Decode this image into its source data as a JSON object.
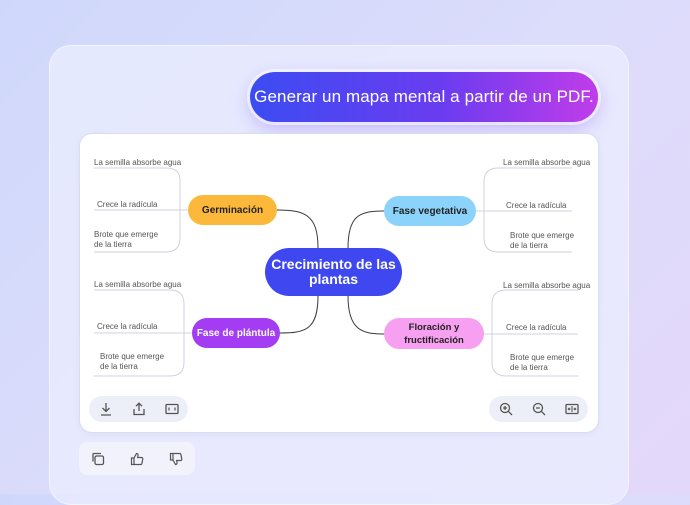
{
  "prompt": {
    "text": "Generar un mapa mental a partir de un PDF."
  },
  "mindmap": {
    "center": "Crecimiento de las plantas",
    "branches": [
      {
        "id": "germ",
        "label": "Germinación",
        "color": "#fcb83b",
        "leaves": [
          "La semilla absorbe agua",
          "Crece la radícula",
          "Brote que emerge de la tierra"
        ]
      },
      {
        "id": "veg",
        "label": "Fase vegetativa",
        "color": "#8bd3fb",
        "leaves": [
          "La semilla absorbe agua",
          "Crece la radícula",
          "Brote que emerge de la tierra"
        ]
      },
      {
        "id": "plant",
        "label": "Fase de plántula",
        "color": "#a43cf4",
        "leaves": [
          "La semilla absorbe agua",
          "Crece la radícula",
          "Brote que emerge de la tierra"
        ]
      },
      {
        "id": "flor",
        "label": "Floración y fructificación",
        "color": "#f79ff0",
        "leaves": [
          "La semilla absorbe agua",
          "Crece la radícula",
          "Brote que emerge de la tierra"
        ]
      }
    ]
  },
  "toolbars": {
    "left": [
      "download-icon",
      "share-icon",
      "fit-screen-icon"
    ],
    "right": [
      "zoom-in-icon",
      "zoom-out-icon",
      "fit-width-icon"
    ],
    "bottom": [
      "copy-icon",
      "thumbs-up-icon",
      "thumbs-down-icon"
    ]
  },
  "colors": {
    "center": "#3f48f0",
    "prompt_start": "#3c4cf2",
    "prompt_end": "#c13ce9"
  }
}
